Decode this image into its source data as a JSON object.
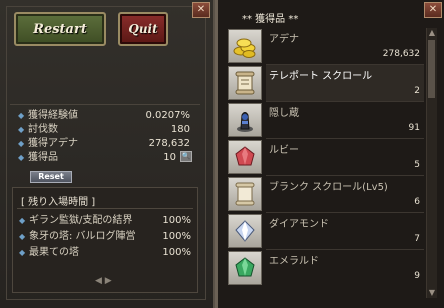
{
  "left": {
    "restart_label": "Restart",
    "quit_label": "Quit",
    "stats": [
      {
        "label": "獲得経験値",
        "value": "0.0207%"
      },
      {
        "label": "討伐数",
        "value": "180"
      },
      {
        "label": "獲得アデナ",
        "value": "278,632"
      },
      {
        "label": "獲得品",
        "value": "10"
      }
    ],
    "reset_label": "Reset",
    "dungeon_header": "[ 残り入場時間 ]",
    "dungeons": [
      {
        "label": "ギラン監獄/支配の結界",
        "value": "100%"
      },
      {
        "label": "象牙の塔: バルログ陣営",
        "value": "100%"
      },
      {
        "label": "最果ての塔",
        "value": "100%"
      }
    ],
    "pager": "◀ ▶"
  },
  "right": {
    "title": "** 獲得品 **",
    "items": [
      {
        "name": "アデナ",
        "count": "278,632",
        "icon": "adena-coins-icon"
      },
      {
        "name": "テレポート スクロール",
        "count": "2",
        "icon": "teleport-scroll-icon"
      },
      {
        "name": "隠し蔵",
        "count": "91",
        "icon": "hidden-storage-icon"
      },
      {
        "name": "ルビー",
        "count": "5",
        "icon": "ruby-icon"
      },
      {
        "name": "ブランク スクロール(Lv5)",
        "count": "6",
        "icon": "blank-scroll-icon"
      },
      {
        "name": "ダイアモンド",
        "count": "7",
        "icon": "diamond-icon"
      },
      {
        "name": "エメラルド",
        "count": "9",
        "icon": "emerald-icon"
      }
    ]
  },
  "close_glyph": "✕"
}
